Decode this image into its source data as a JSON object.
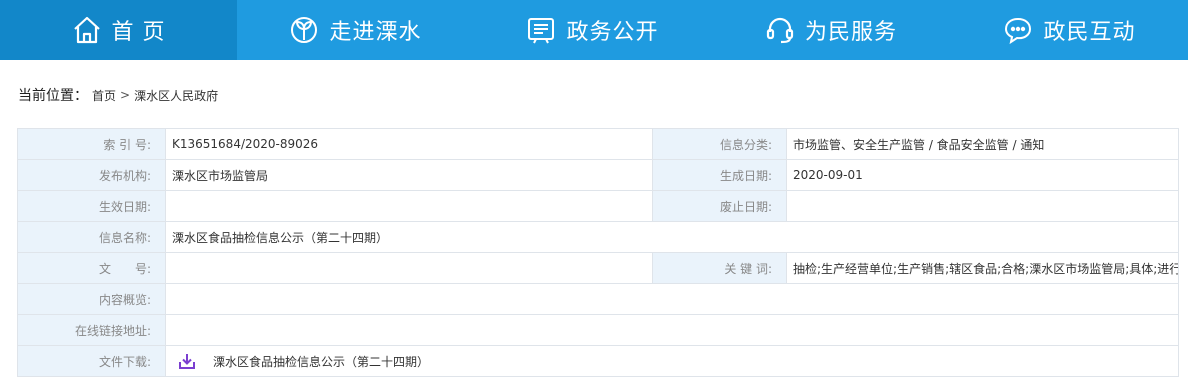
{
  "nav": {
    "items": [
      {
        "label": "首 页",
        "icon": "home-icon"
      },
      {
        "label": "走进溧水",
        "icon": "sprout-icon"
      },
      {
        "label": "政务公开",
        "icon": "document-icon"
      },
      {
        "label": "为民服务",
        "icon": "headset-icon"
      },
      {
        "label": "政民互动",
        "icon": "chat-icon"
      }
    ],
    "active_color": "#1287c9",
    "bar_color": "#1f9be0"
  },
  "breadcrumb": {
    "head": "当前位置：",
    "items": [
      "首页",
      "溧水区人民政府"
    ],
    "separator": ">"
  },
  "info": {
    "index_no_label": "索 引 号:",
    "index_no": "K13651684/2020-89026",
    "category_label": "信息分类:",
    "category": "市场监管、安全生产监管 / 食品安全监管 / 通知",
    "publisher_label": "发布机构:",
    "publisher": "溧水区市场监管局",
    "created_label": "生成日期:",
    "created": "2020-09-01",
    "effective_label": "生效日期:",
    "effective": "",
    "expire_label": "废止日期:",
    "expire": "",
    "name_label": "信息名称:",
    "name": "溧水区食品抽检信息公示（第二十四期）",
    "doc_no_label": "文　　号:",
    "doc_no": "",
    "keywords_label": "关 键 词:",
    "keywords": "抽检;生产经营单位;生产销售;辖区食品;合格;溧水区市场监管局;具体;进行",
    "summary_label": "内容概览:",
    "summary": "",
    "link_label": "在线链接地址:",
    "link": "",
    "download_label": "文件下载:",
    "download_icon": "download-icon",
    "download_file": "溧水区食品抽检信息公示（第二十四期）"
  }
}
